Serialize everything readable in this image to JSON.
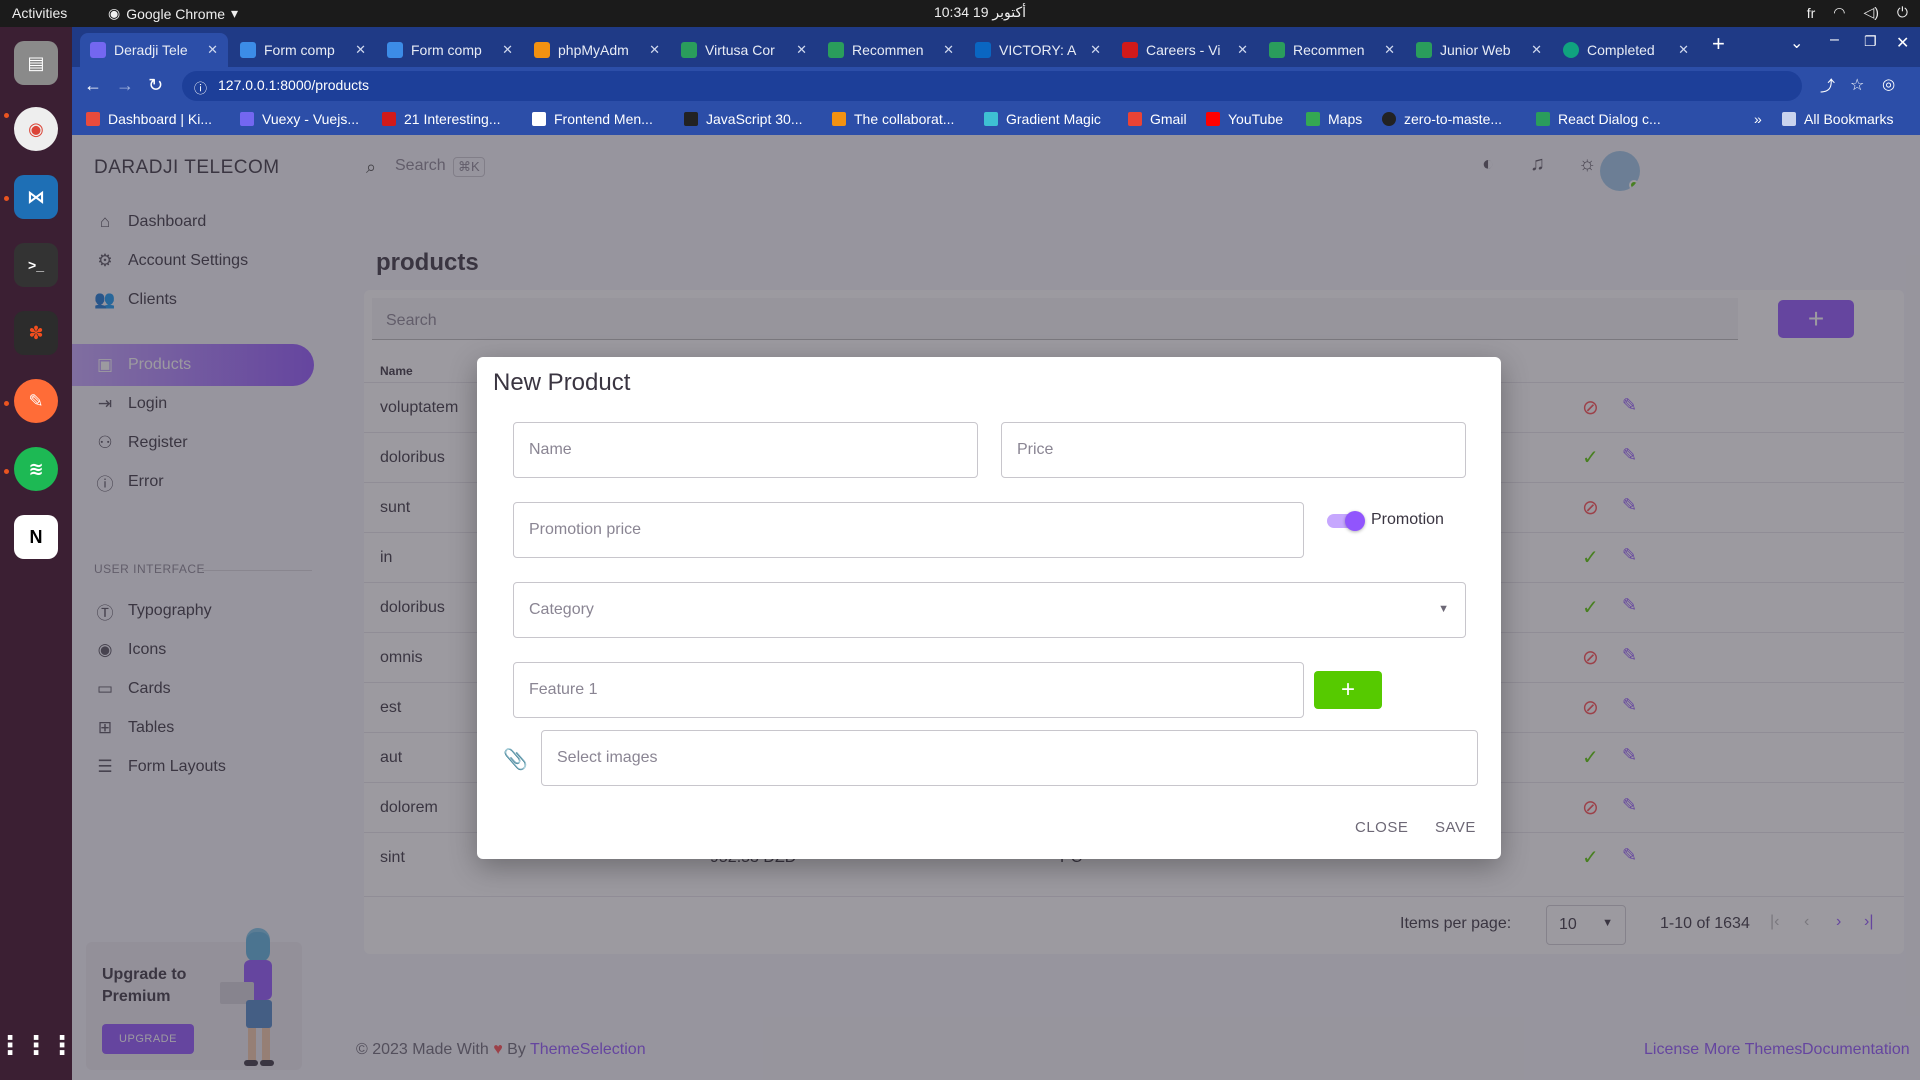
{
  "os": {
    "activities": "Activities",
    "app_name": "Google Chrome",
    "clock": "10:34  19 أكتوبر",
    "lang": "fr"
  },
  "browser": {
    "tabs": [
      {
        "label": "Deradji Tele",
        "active": true,
        "color": "#7367f0"
      },
      {
        "label": "Form comp",
        "active": false,
        "color": "#3c8ce7"
      },
      {
        "label": "Form comp",
        "active": false,
        "color": "#3c8ce7"
      },
      {
        "label": "phpMyAdm",
        "active": false,
        "color": "#f29111"
      },
      {
        "label": "Virtusa Cor",
        "active": false,
        "color": "#2a9d5c"
      },
      {
        "label": "Recommen",
        "active": false,
        "color": "#2a9d5c"
      },
      {
        "label": "VICTORY: A",
        "active": false,
        "color": "#0a66c2"
      },
      {
        "label": "Careers - Vi",
        "active": false,
        "color": "#d11a1a"
      },
      {
        "label": "Recommen",
        "active": false,
        "color": "#2a9d5c"
      },
      {
        "label": "Junior Web",
        "active": false,
        "color": "#2a9d5c"
      },
      {
        "label": "Completed",
        "active": false,
        "color": "#10a37f"
      }
    ],
    "url": "127.0.0.1:8000/products",
    "bookmarks": [
      {
        "label": "Dashboard | Ki...",
        "color": "#e94b3c"
      },
      {
        "label": "Vuexy - Vuejs...",
        "color": "#7367f0"
      },
      {
        "label": "21 Interesting...",
        "color": "#d11a1a"
      },
      {
        "label": "Frontend Men...",
        "color": "#ffffff"
      },
      {
        "label": "JavaScript 30...",
        "color": "#222222"
      },
      {
        "label": "The collaborat...",
        "color": "#f29111"
      },
      {
        "label": "Gradient Magic",
        "color": "#3ec1d3"
      },
      {
        "label": "Gmail",
        "color": "#ea4335"
      },
      {
        "label": "YouTube",
        "color": "#ff0000"
      },
      {
        "label": "Maps",
        "color": "#34a853"
      },
      {
        "label": "zero-to-maste...",
        "color": "#222222"
      },
      {
        "label": "React Dialog c...",
        "color": "#2a9d5c"
      }
    ],
    "all_bookmarks": "All Bookmarks"
  },
  "sidebar": {
    "brand": "DARADJI TELECOM",
    "items": [
      {
        "label": "Dashboard",
        "icon": "home-icon",
        "active": false
      },
      {
        "label": "Account Settings",
        "icon": "account-cog-icon",
        "active": false
      },
      {
        "label": "Clients",
        "icon": "users-icon",
        "active": false
      },
      {
        "label": "Products",
        "icon": "products-icon",
        "active": true
      },
      {
        "label": "Login",
        "icon": "login-icon",
        "active": false
      },
      {
        "label": "Register",
        "icon": "register-icon",
        "active": false
      },
      {
        "label": "Error",
        "icon": "info-icon",
        "active": false
      }
    ],
    "section_title": "USER INTERFACE",
    "ui_items": [
      {
        "label": "Typography",
        "icon": "typography-icon"
      },
      {
        "label": "Icons",
        "icon": "eye-icon"
      },
      {
        "label": "Cards",
        "icon": "card-icon"
      },
      {
        "label": "Tables",
        "icon": "table-icon"
      },
      {
        "label": "Form Layouts",
        "icon": "form-icon"
      }
    ],
    "upgrade": {
      "title": "Upgrade to Premium",
      "button": "UPGRADE"
    }
  },
  "topnav": {
    "search_placeholder": "Search",
    "shortcut": "⌘K"
  },
  "page": {
    "title": "products",
    "search_placeholder": "Search",
    "add_symbol": "+",
    "columns": {
      "name": "Name"
    },
    "rows": [
      {
        "name": "voluptatem",
        "price": "",
        "category": "",
        "status": "inactive"
      },
      {
        "name": "doloribus",
        "price": "",
        "category": "",
        "status": "active"
      },
      {
        "name": "sunt",
        "price": "",
        "category": "",
        "status": "inactive"
      },
      {
        "name": "in",
        "price": "",
        "category": "",
        "status": "active"
      },
      {
        "name": "doloribus",
        "price": "",
        "category": "",
        "status": "active"
      },
      {
        "name": "omnis",
        "price": "",
        "category": "",
        "status": "inactive"
      },
      {
        "name": "est",
        "price": "",
        "category": "",
        "status": "inactive"
      },
      {
        "name": "aut",
        "price": "",
        "category": "",
        "status": "active"
      },
      {
        "name": "dolorem",
        "price": "",
        "category": "",
        "status": "inactive"
      },
      {
        "name": "sint",
        "price": "952.53 DZD",
        "category": "PC",
        "status": "active"
      }
    ],
    "pagination": {
      "items_per_page_label": "Items per page:",
      "items_per_page": "10",
      "range": "1-10 of 1634"
    }
  },
  "footer": {
    "copyright": "© 2023 Made With",
    "by": "By",
    "brand": "ThemeSelection",
    "links": [
      "License",
      "More Themes",
      "Documentation"
    ]
  },
  "dialog": {
    "title": "New Product",
    "name_placeholder": "Name",
    "price_placeholder": "Price",
    "promotion_price_placeholder": "Promotion price",
    "promotion_label": "Promotion",
    "promotion_enabled": true,
    "category_placeholder": "Category",
    "feature_placeholder": "Feature 1",
    "feature_add": "+",
    "images_placeholder": "Select images",
    "close_label": "CLOSE",
    "save_label": "SAVE"
  }
}
